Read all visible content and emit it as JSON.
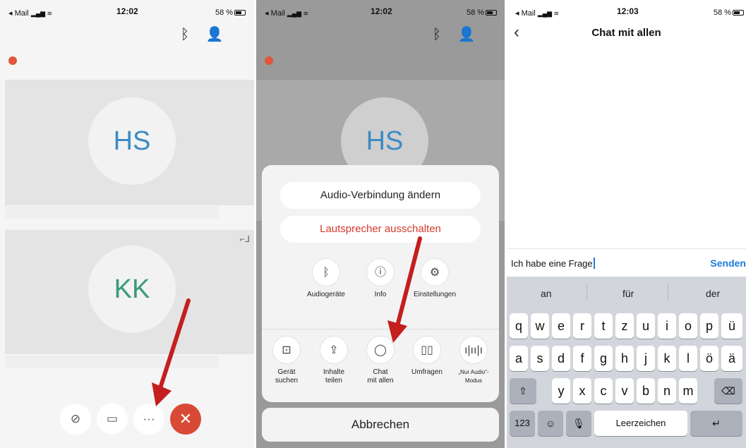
{
  "status": {
    "carrier": "◂ Mail",
    "time_1": "12:02",
    "time_2": "12:02",
    "time_3": "12:03",
    "battery": "58 %"
  },
  "call": {
    "participants": [
      "HS",
      "KK"
    ]
  },
  "menu": {
    "audio_connection": "Audio-Verbindung ändern",
    "speaker_off": "Lautsprecher ausschalten",
    "options_row1": [
      {
        "label": "Audiogeräte",
        "icon": "bluetooth-icon"
      },
      {
        "label": "Info",
        "icon": "info-icon"
      },
      {
        "label": "Einstellungen",
        "icon": "gear-icon"
      }
    ],
    "options_row2": [
      {
        "label_line1": "Gerät",
        "label_line2": "suchen",
        "icon": "cast-icon"
      },
      {
        "label_line1": "Inhalte",
        "label_line2": "teilen",
        "icon": "share-icon"
      },
      {
        "label_line1": "Chat",
        "label_line2": "mit allen",
        "icon": "chat-icon"
      },
      {
        "label_line1": "Umfragen",
        "label_line2": "",
        "icon": "poll-icon"
      },
      {
        "label_line1": "„Nur Audio“-",
        "label_line2": "Modus",
        "icon": "audio-wave-icon"
      }
    ],
    "cancel": "Abbrechen"
  },
  "chat": {
    "title": "Chat mit allen",
    "input_value": "Ich habe eine Frage",
    "send": "Senden"
  },
  "keyboard": {
    "suggestions": [
      "an",
      "für",
      "der"
    ],
    "row1": [
      "q",
      "w",
      "e",
      "r",
      "t",
      "z",
      "u",
      "i",
      "o",
      "p",
      "ü"
    ],
    "row2": [
      "a",
      "s",
      "d",
      "f",
      "g",
      "h",
      "j",
      "k",
      "l",
      "ö",
      "ä"
    ],
    "row3": [
      "y",
      "x",
      "c",
      "v",
      "b",
      "n",
      "m"
    ],
    "numbers_key": "123",
    "space": "Leerzeichen"
  },
  "colors": {
    "accent_blue": "#1e7cd9",
    "end_call_red": "#d84a36",
    "warning_red": "#d33b2c"
  }
}
